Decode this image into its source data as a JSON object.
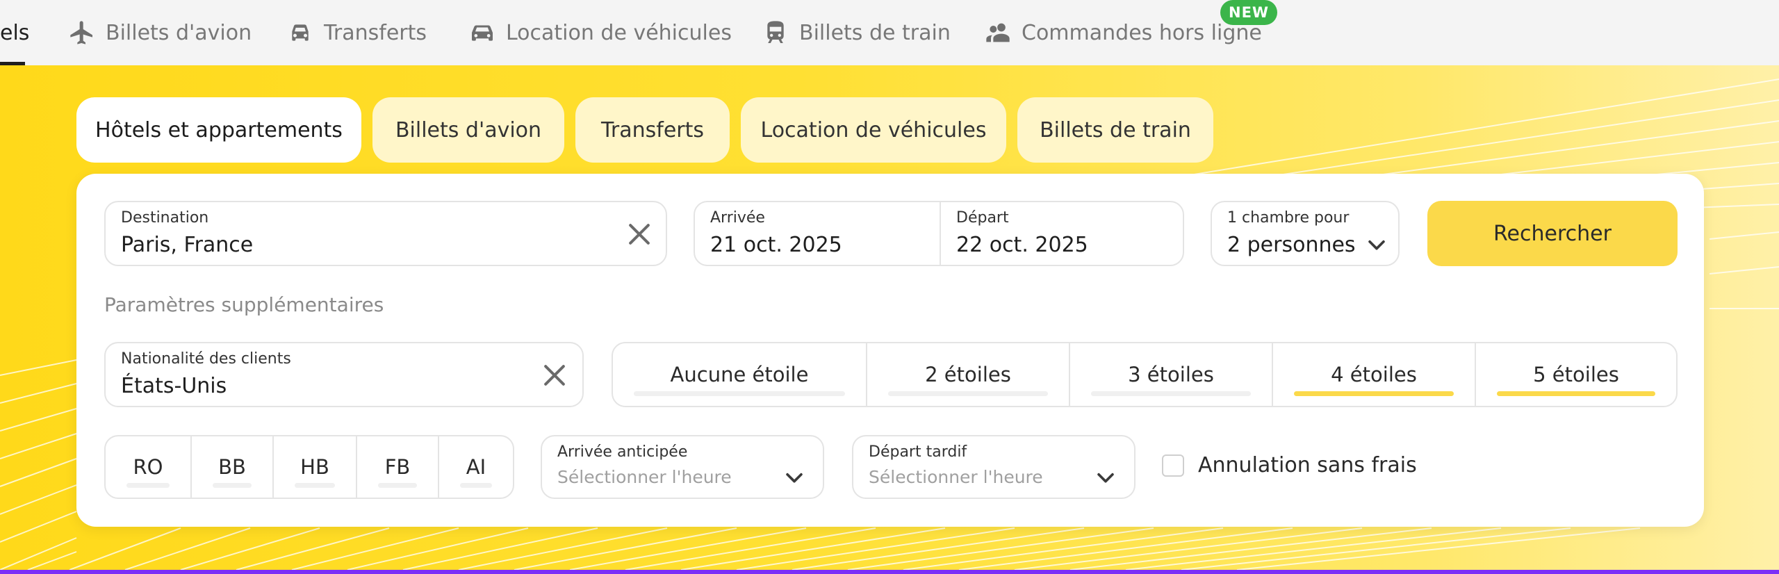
{
  "topnav": {
    "items": [
      {
        "label": "els",
        "icon": "hotel-icon"
      },
      {
        "label": "Billets d'avion",
        "icon": "airplane-icon"
      },
      {
        "label": "Transferts",
        "icon": "car-front-icon"
      },
      {
        "label": "Location de véhicules",
        "icon": "car-rental-icon"
      },
      {
        "label": "Billets de train",
        "icon": "train-icon"
      },
      {
        "label": "Commandes hors ligne",
        "icon": "people-icon"
      }
    ],
    "badge": "NEW"
  },
  "tabs": [
    {
      "label": "Hôtels et appartements",
      "active": true
    },
    {
      "label": "Billets d'avion",
      "active": false
    },
    {
      "label": "Transferts",
      "active": false
    },
    {
      "label": "Location de véhicules",
      "active": false
    },
    {
      "label": "Billets de train",
      "active": false
    }
  ],
  "search": {
    "destination": {
      "label": "Destination",
      "value": "Paris, France"
    },
    "checkin": {
      "label": "Arrivée",
      "value": "21 oct. 2025"
    },
    "checkout": {
      "label": "Départ",
      "value": "22 oct. 2025"
    },
    "rooms": {
      "label": "1 chambre pour",
      "value": "2 personnes"
    },
    "button": "Rechercher"
  },
  "extra": {
    "title": "Paramètres supplémentaires",
    "nationality": {
      "label": "Nationalité des clients",
      "value": "États-Unis"
    },
    "stars": [
      {
        "label": "Aucune étoile",
        "selected": false
      },
      {
        "label": "2 étoiles",
        "selected": false
      },
      {
        "label": "3 étoiles",
        "selected": false
      },
      {
        "label": "4 étoiles",
        "selected": true
      },
      {
        "label": "5 étoiles",
        "selected": true
      }
    ],
    "meals": [
      "RO",
      "BB",
      "HB",
      "FB",
      "AI"
    ],
    "early_checkin": {
      "label": "Arrivée anticipée",
      "placeholder": "Sélectionner l'heure"
    },
    "late_checkout": {
      "label": "Départ tardif",
      "placeholder": "Sélectionner l'heure"
    },
    "free_cancellation": {
      "label": "Annulation sans frais",
      "checked": false
    }
  },
  "colors": {
    "accent": "#fbd94a",
    "hero": "#ffd91a",
    "badge": "#3bb54a",
    "bottom_bar": "#7b2ff7"
  }
}
